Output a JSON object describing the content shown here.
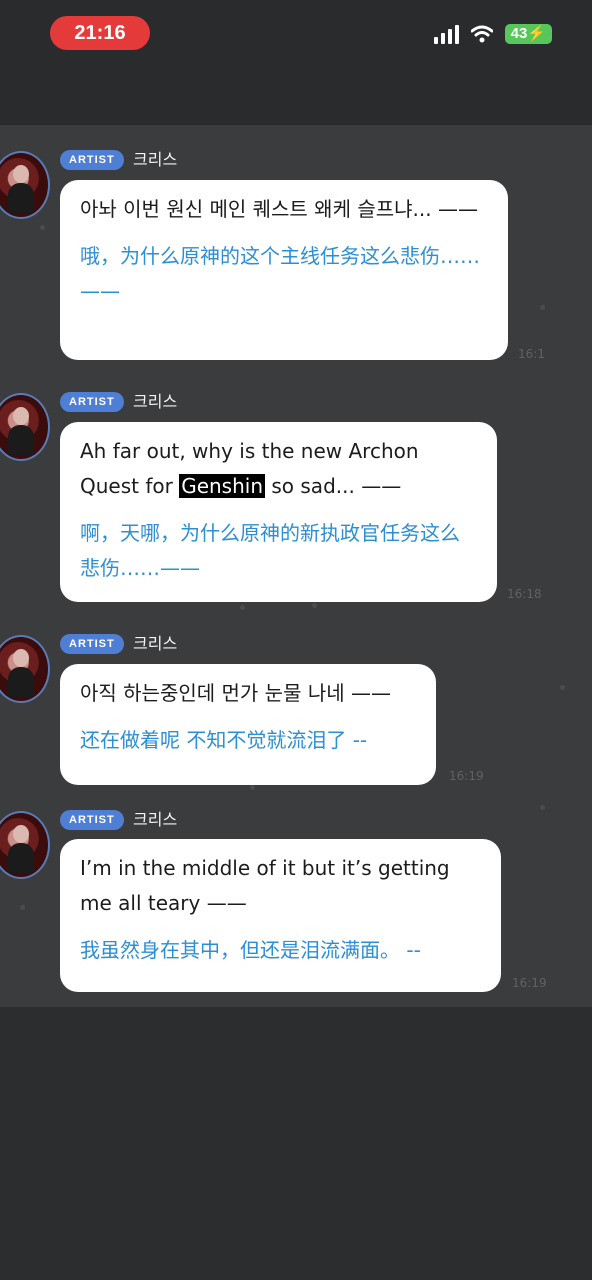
{
  "status_bar": {
    "time": "21:16",
    "battery": "43"
  },
  "messages": [
    {
      "badge": "ARTIST",
      "sender": "크리스",
      "original": "아놔 이번 원신 메인 퀘스트 왜케 슬프냐... ——",
      "translation": "哦，为什么原神的这个主线任务这么悲伤……——",
      "time": "16:1"
    },
    {
      "badge": "ARTIST",
      "sender": "크리스",
      "original_before": "Ah far out, why is the new Archon Quest for ",
      "original_highlight": "Genshin",
      "original_after": " so sad... ——",
      "translation": "啊，天哪，为什么原神的新执政官任务这么悲伤……——",
      "time": "16:18"
    },
    {
      "badge": "ARTIST",
      "sender": "크리스",
      "original": "아직 하는중인데 먼가 눈물 나네 ——",
      "translation": "还在做着呢 不知不觉就流泪了 --",
      "time": "16:19"
    },
    {
      "badge": "ARTIST",
      "sender": "크리스",
      "original": "I’m in the middle of it but it’s getting me all teary ——",
      "translation": "我虽然身在其中，但还是泪流满面。 --",
      "time": "16:19"
    }
  ]
}
